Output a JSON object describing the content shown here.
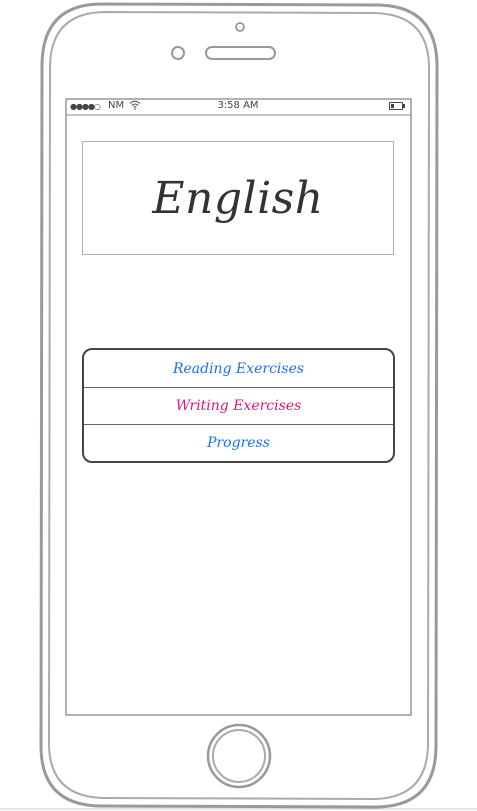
{
  "status_bar": {
    "signal": "●●●●○",
    "carrier": "NM",
    "time": "3:58 AM"
  },
  "title": "English",
  "menu": {
    "items": [
      {
        "label": "Reading Exercises",
        "color": "#1a73e8"
      },
      {
        "label": "Writing Exercises",
        "color": "#e0157a"
      },
      {
        "label": "Progress",
        "color": "#1a73e8"
      }
    ]
  },
  "colors": {
    "frame": "#999999",
    "screen_border": "#666666",
    "text": "#333333"
  },
  "icons": [
    "wifi-icon",
    "battery-icon",
    "speaker-icon",
    "camera-icon",
    "home-button-icon"
  ]
}
